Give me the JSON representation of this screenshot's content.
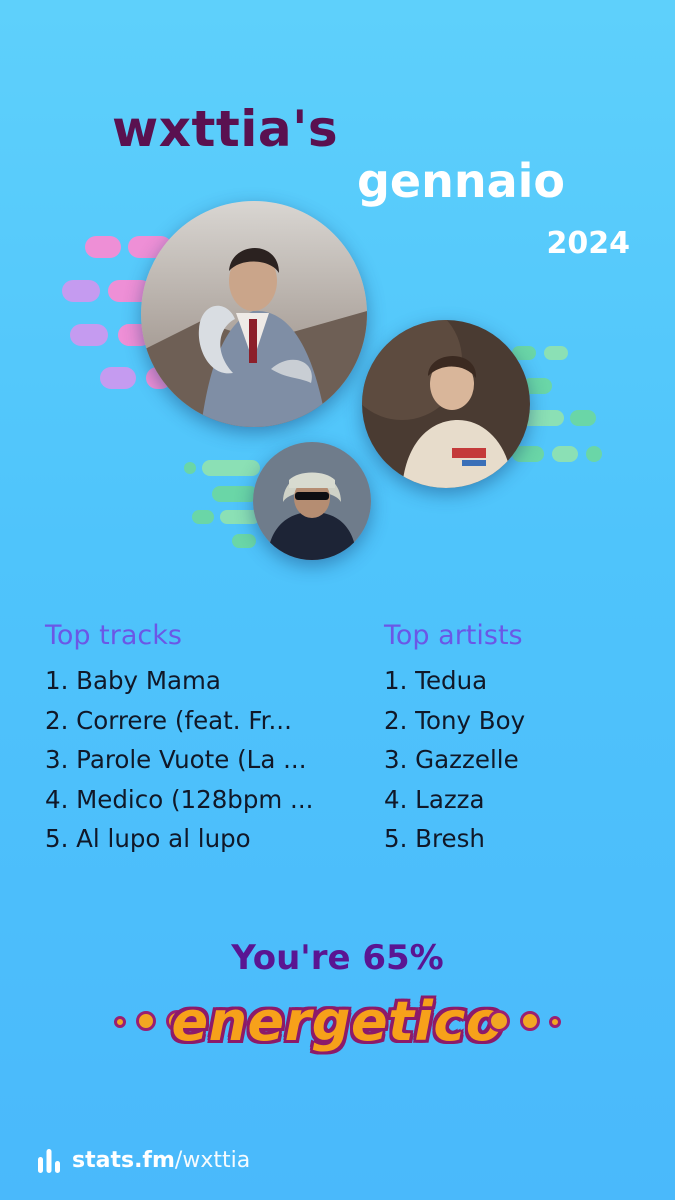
{
  "header": {
    "username": "wxttia's",
    "month": "gennaio",
    "year": "2024"
  },
  "artists_images": [
    {
      "name": "tedua-photo"
    },
    {
      "name": "tony-boy-photo"
    },
    {
      "name": "gazzelle-photo"
    }
  ],
  "top_tracks": {
    "heading": "Top tracks",
    "items": [
      "1. Baby Mama",
      "2. Correre (feat. Fr...",
      "3. Parole Vuote (La ...",
      "4. Medico (128bpm ...",
      "5. Al lupo al lupo"
    ]
  },
  "top_artists": {
    "heading": "Top artists",
    "items": [
      "1. Tedua",
      "2. Tony Boy",
      "3. Gazzelle",
      "4. Lazza",
      "5. Bresh"
    ]
  },
  "mood": {
    "line": "You're 65%",
    "word": "energetico"
  },
  "footer": {
    "site": "stats.fm",
    "handle": "/wxttia",
    "icon": "bar-chart-icon"
  },
  "colors": {
    "background": "#4fc4fb",
    "username": "#5a1150",
    "heading": "#6b57e6",
    "mood_line": "#5a1592",
    "mood_word_fill": "#f7a11a",
    "mood_word_outline": "#8c1a6a"
  }
}
